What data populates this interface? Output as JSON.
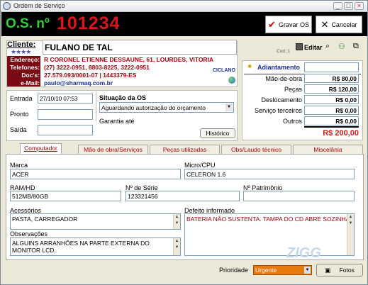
{
  "window": {
    "title": "Ordem de Serviço",
    "min": "_",
    "max": "□",
    "close": "×"
  },
  "header": {
    "os_label": "O.S. nº",
    "os_number": "101234",
    "save_label": "Gravar OS",
    "cancel_label": "Cancelar"
  },
  "client": {
    "label": "Cliente:",
    "stars": "★★★★",
    "name": "FULANO DE TAL",
    "cod": "Cod.:1",
    "rows": [
      {
        "label": "Endereço:",
        "value": "R CORONEL ETIENNE DESSAUNE, 61, LOURDES, VITORIA"
      },
      {
        "label": "Telefones:",
        "value": "(27) 3222-0951, 8803-8225, 3222-0951"
      },
      {
        "label": "Doc's:",
        "value": "27.579.093/0001-07 | 1443379-ES"
      },
      {
        "label": "e-Mail:",
        "value": "paulo@sharmaq.com.br"
      }
    ],
    "tag": "CICLANO"
  },
  "toolbar": {
    "editar_label": "Editar"
  },
  "totals": {
    "adiantamento_label": "Adiantamento",
    "adiantamento_value": "",
    "rows": [
      {
        "label": "Mão-de-obra",
        "value": "R$ 80,00"
      },
      {
        "label": "Peças",
        "value": "R$ 120,00"
      },
      {
        "label": "Deslocamento",
        "value": "R$ 0,00"
      },
      {
        "label": "Serviço terceiros",
        "value": "R$ 0,00"
      },
      {
        "label": "Outros",
        "value": "R$ 0,00"
      }
    ],
    "total": "R$ 200,00"
  },
  "dates": {
    "entrada_label": "Entrada",
    "entrada_value": "27/10/10 07:53",
    "pronto_label": "Pronto",
    "saida_label": "Saída"
  },
  "status": {
    "label": "Situação da OS",
    "value": "Aguardando autorização do orçamento",
    "garantia_label": "Garantia até",
    "historico_label": "Histórico"
  },
  "tabs": [
    "Computador",
    "Mão de obra/Serviços",
    "Peças utilizadas",
    "Obs/Laudo técnico",
    "Miscelânia"
  ],
  "form": {
    "marca_label": "Marca",
    "marca": "ACER",
    "cpu_label": "Micro/CPU",
    "cpu": "CELERON 1.6",
    "ram_label": "RAM/HD",
    "ram": "512MB/80GB",
    "serie_label": "Nº de Série",
    "serie": "123321456",
    "patrimonio_label": "Nº Patrimônio",
    "patrimonio": "",
    "acessorios_label": "Acessórios",
    "acessorios": "PASTA, CARREGADOR",
    "defeito_label": "Defeito informado",
    "defeito": "BATERIA NÃO SUSTENTA. TAMPA DO CD ABRE SOZINHA",
    "obs_label": "Observações",
    "obs": "ALGUINS ARRANHÕES NA PARTE EXTERNA DO MONITOR LCD."
  },
  "footer": {
    "prioridade_label": "Prioridade",
    "prioridade_value": "Urgente",
    "fotos_label": "Fotos",
    "watermark": "ZIGG"
  }
}
